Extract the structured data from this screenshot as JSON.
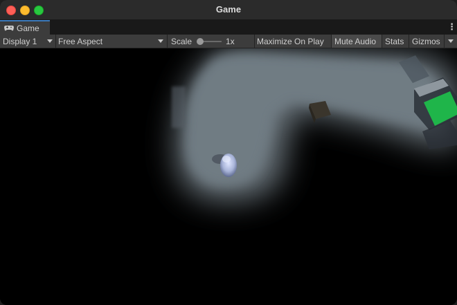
{
  "window": {
    "title": "Game"
  },
  "tabs": [
    {
      "label": "Game",
      "icon": "gamepad-icon",
      "active": true
    }
  ],
  "toolbar": {
    "display": "Display 1",
    "aspect": "Free Aspect",
    "scale_label": "Scale",
    "scale_value": "1x",
    "scale_level": 0,
    "maximize_on_play": "Maximize On Play",
    "mute_audio": "Mute Audio",
    "mute_audio_active": true,
    "stats": "Stats",
    "gizmos": "Gizmos"
  },
  "colors": {
    "titlebar": "#2b2b2b",
    "tab_accent": "#3a79bb",
    "toolbar": "#3c3c3c",
    "fog_light": "#6e7880",
    "player": "#a8b4d8",
    "crate_green": "#1fb54a"
  }
}
